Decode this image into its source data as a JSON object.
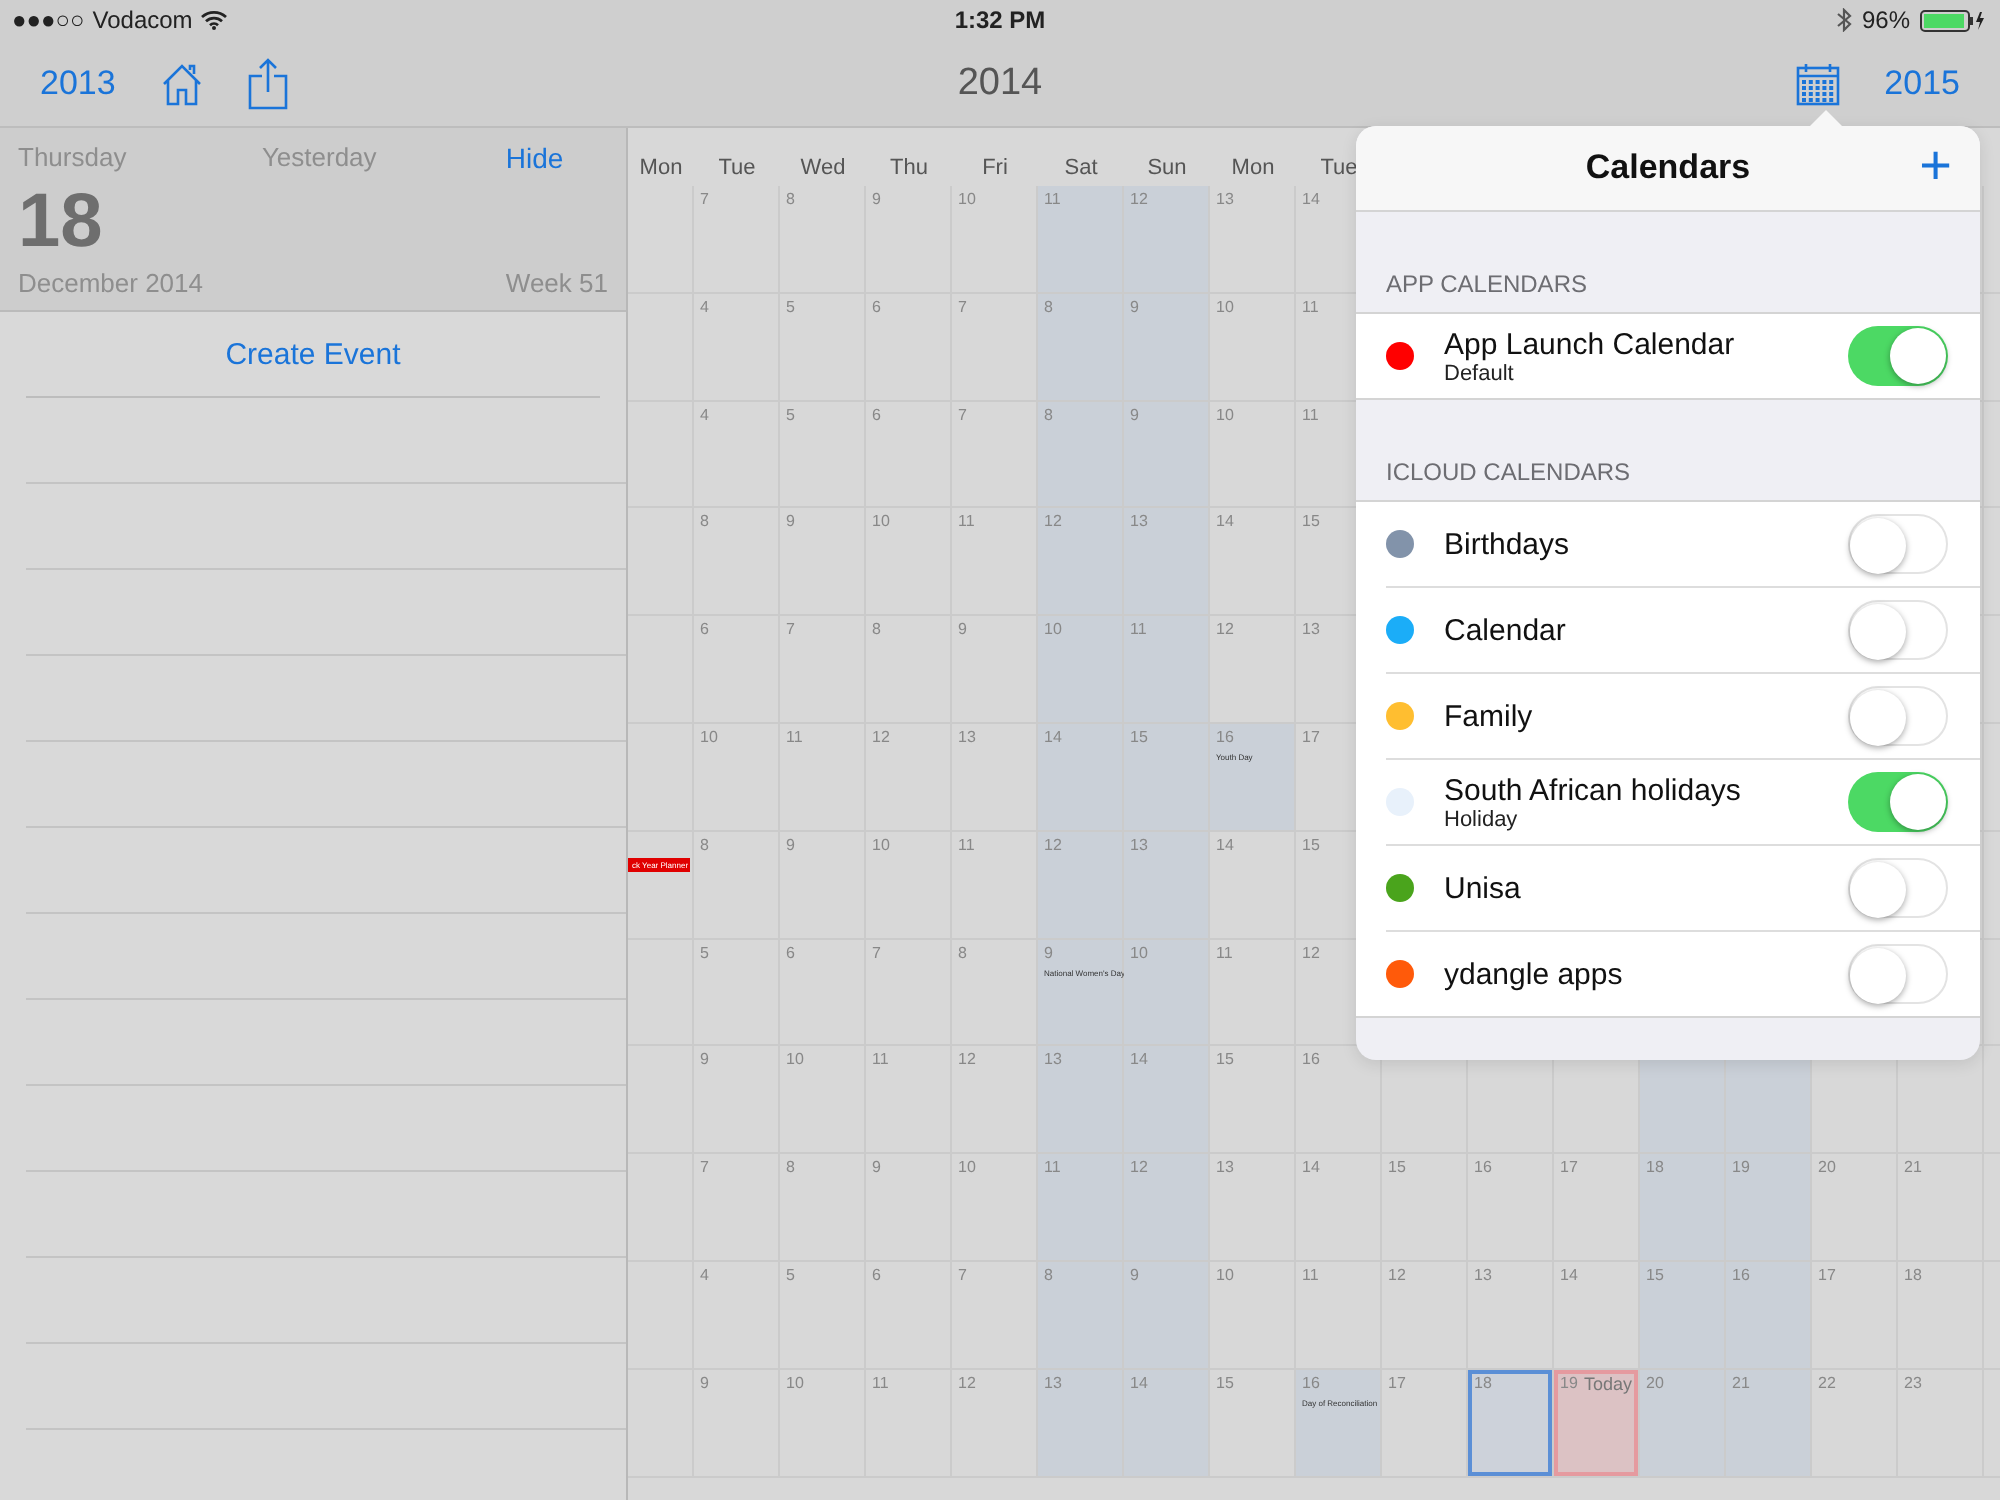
{
  "status_bar": {
    "signal": "●●●○○",
    "carrier": "Vodacom",
    "time": "1:32 PM",
    "battery": "96%"
  },
  "nav": {
    "previous_year": "2013",
    "title": "2014",
    "next_year": "2015"
  },
  "day_panel": {
    "weekday": "Thursday",
    "relative": "Yesterday",
    "hide": "Hide",
    "day": "18",
    "month_year": "December 2014",
    "week": "Week 51",
    "create_event": "Create Event"
  },
  "year_grid": {
    "headers": [
      "Mon",
      "Tue",
      "Wed",
      "Thu",
      "Fri",
      "Sat",
      "Sun",
      "Mon",
      "Tue"
    ],
    "months": [
      {
        "cells": [
          {
            "kind": "blank"
          },
          {
            "kind": "weekday",
            "day": "7"
          },
          {
            "kind": "weekday",
            "day": "8"
          },
          {
            "kind": "weekday",
            "day": "9"
          },
          {
            "kind": "weekday",
            "day": "10"
          },
          {
            "kind": "weekend",
            "day": "11"
          },
          {
            "kind": "weekend",
            "day": "12"
          },
          {
            "kind": "weekday",
            "day": "13"
          },
          {
            "kind": "weekday",
            "day": "14"
          }
        ]
      },
      {
        "cells": [
          {
            "kind": "blank"
          },
          {
            "kind": "weekday",
            "day": "4"
          },
          {
            "kind": "weekday",
            "day": "5"
          },
          {
            "kind": "weekday",
            "day": "6"
          },
          {
            "kind": "weekday",
            "day": "7"
          },
          {
            "kind": "weekend",
            "day": "8"
          },
          {
            "kind": "weekend",
            "day": "9"
          },
          {
            "kind": "weekday",
            "day": "10"
          },
          {
            "kind": "weekday",
            "day": "11"
          }
        ]
      },
      {
        "cells": [
          {
            "kind": "blank"
          },
          {
            "kind": "weekday",
            "day": "4"
          },
          {
            "kind": "weekday",
            "day": "5"
          },
          {
            "kind": "weekday",
            "day": "6"
          },
          {
            "kind": "weekday",
            "day": "7"
          },
          {
            "kind": "weekend",
            "day": "8"
          },
          {
            "kind": "weekend",
            "day": "9"
          },
          {
            "kind": "weekday",
            "day": "10"
          },
          {
            "kind": "weekday",
            "day": "11"
          }
        ]
      },
      {
        "cells": [
          {
            "kind": "blank"
          },
          {
            "kind": "weekday",
            "day": "8"
          },
          {
            "kind": "weekday",
            "day": "9"
          },
          {
            "kind": "weekday",
            "day": "10"
          },
          {
            "kind": "weekday",
            "day": "11"
          },
          {
            "kind": "weekend",
            "day": "12"
          },
          {
            "kind": "weekend",
            "day": "13"
          },
          {
            "kind": "weekday",
            "day": "14"
          },
          {
            "kind": "weekday",
            "day": "15"
          }
        ]
      },
      {
        "cells": [
          {
            "kind": "blank"
          },
          {
            "kind": "weekday",
            "day": "6"
          },
          {
            "kind": "weekday",
            "day": "7"
          },
          {
            "kind": "weekday",
            "day": "8"
          },
          {
            "kind": "weekday",
            "day": "9"
          },
          {
            "kind": "weekend",
            "day": "10"
          },
          {
            "kind": "weekend",
            "day": "11"
          },
          {
            "kind": "weekday",
            "day": "12"
          },
          {
            "kind": "weekday",
            "day": "13"
          }
        ]
      },
      {
        "cells": [
          {
            "kind": "blank"
          },
          {
            "kind": "weekday",
            "day": "10"
          },
          {
            "kind": "weekday",
            "day": "11"
          },
          {
            "kind": "weekday",
            "day": "12"
          },
          {
            "kind": "weekday",
            "day": "13"
          },
          {
            "kind": "weekend",
            "day": "14"
          },
          {
            "kind": "weekend",
            "day": "15"
          },
          {
            "kind": "holiday",
            "day": "16",
            "note": "Youth Day"
          },
          {
            "kind": "weekday",
            "day": "17"
          }
        ]
      },
      {
        "cells": [
          {
            "kind": "event",
            "note": "ck Year Planner",
            "color": "#e00000"
          },
          {
            "kind": "weekday",
            "day": "8"
          },
          {
            "kind": "weekday",
            "day": "9"
          },
          {
            "kind": "weekday",
            "day": "10"
          },
          {
            "kind": "weekday",
            "day": "11"
          },
          {
            "kind": "weekend",
            "day": "12"
          },
          {
            "kind": "weekend",
            "day": "13"
          },
          {
            "kind": "weekday",
            "day": "14"
          },
          {
            "kind": "weekday",
            "day": "15"
          }
        ]
      },
      {
        "cells": [
          {
            "kind": "blank"
          },
          {
            "kind": "weekday",
            "day": "5"
          },
          {
            "kind": "weekday",
            "day": "6"
          },
          {
            "kind": "weekday",
            "day": "7"
          },
          {
            "kind": "weekday",
            "day": "8"
          },
          {
            "kind": "holiday",
            "day": "9",
            "note": "National Women's Day"
          },
          {
            "kind": "weekend",
            "day": "10"
          },
          {
            "kind": "weekday",
            "day": "11"
          },
          {
            "kind": "weekday",
            "day": "12"
          }
        ]
      },
      {
        "cells": [
          {
            "kind": "blank"
          },
          {
            "kind": "weekday",
            "day": "9"
          },
          {
            "kind": "weekday",
            "day": "10"
          },
          {
            "kind": "weekday",
            "day": "11"
          },
          {
            "kind": "weekday",
            "day": "12"
          },
          {
            "kind": "weekend",
            "day": "13"
          },
          {
            "kind": "weekend",
            "day": "14"
          },
          {
            "kind": "weekday",
            "day": "15"
          },
          {
            "kind": "weekday",
            "day": "16"
          },
          {
            "kind": "blank"
          },
          {
            "kind": "blank"
          },
          {
            "kind": "blank"
          },
          {
            "kind": "weekend"
          },
          {
            "kind": "weekend"
          }
        ]
      },
      {
        "cells": [
          {
            "kind": "blank"
          },
          {
            "kind": "weekday",
            "day": "7"
          },
          {
            "kind": "weekday",
            "day": "8"
          },
          {
            "kind": "weekday",
            "day": "9"
          },
          {
            "kind": "weekday",
            "day": "10"
          },
          {
            "kind": "weekend",
            "day": "11"
          },
          {
            "kind": "weekend",
            "day": "12"
          },
          {
            "kind": "weekday",
            "day": "13"
          },
          {
            "kind": "weekday",
            "day": "14"
          },
          {
            "kind": "weekday",
            "day": "15"
          },
          {
            "kind": "weekday",
            "day": "16"
          },
          {
            "kind": "weekday",
            "day": "17"
          },
          {
            "kind": "weekend",
            "day": "18"
          },
          {
            "kind": "weekend",
            "day": "19"
          },
          {
            "kind": "weekday",
            "day": "20"
          },
          {
            "kind": "weekday",
            "day": "21"
          }
        ]
      },
      {
        "cells": [
          {
            "kind": "blank"
          },
          {
            "kind": "weekday",
            "day": "4"
          },
          {
            "kind": "weekday",
            "day": "5"
          },
          {
            "kind": "weekday",
            "day": "6"
          },
          {
            "kind": "weekday",
            "day": "7"
          },
          {
            "kind": "weekend",
            "day": "8"
          },
          {
            "kind": "weekend",
            "day": "9"
          },
          {
            "kind": "weekday",
            "day": "10"
          },
          {
            "kind": "weekday",
            "day": "11"
          },
          {
            "kind": "weekday",
            "day": "12"
          },
          {
            "kind": "weekday",
            "day": "13"
          },
          {
            "kind": "weekday",
            "day": "14"
          },
          {
            "kind": "weekend",
            "day": "15"
          },
          {
            "kind": "weekend",
            "day": "16"
          },
          {
            "kind": "weekday",
            "day": "17"
          },
          {
            "kind": "weekday",
            "day": "18"
          }
        ]
      },
      {
        "cells": [
          {
            "kind": "blank"
          },
          {
            "kind": "weekday",
            "day": "9"
          },
          {
            "kind": "weekday",
            "day": "10"
          },
          {
            "kind": "weekday",
            "day": "11"
          },
          {
            "kind": "weekday",
            "day": "12"
          },
          {
            "kind": "weekend",
            "day": "13"
          },
          {
            "kind": "weekend",
            "day": "14"
          },
          {
            "kind": "weekday",
            "day": "15"
          },
          {
            "kind": "holiday",
            "day": "16",
            "note": "Day of Reconciliation"
          },
          {
            "kind": "weekday",
            "day": "17"
          },
          {
            "kind": "selected",
            "day": "18"
          },
          {
            "kind": "today",
            "day": "19",
            "label": "Today"
          },
          {
            "kind": "weekend",
            "day": "20"
          },
          {
            "kind": "weekend",
            "day": "21"
          },
          {
            "kind": "weekday",
            "day": "22"
          },
          {
            "kind": "weekday",
            "day": "23"
          }
        ]
      }
    ]
  },
  "calendars_popover": {
    "title": "Calendars",
    "add": "+",
    "sections": [
      {
        "header": "APP CALENDARS",
        "items": [
          {
            "name": "App Launch Calendar",
            "subtitle": "Default",
            "color": "#ff0000",
            "on": true
          }
        ]
      },
      {
        "header": "ICLOUD CALENDARS",
        "items": [
          {
            "name": "Birthdays",
            "color": "#8293aa",
            "on": false
          },
          {
            "name": "Calendar",
            "color": "#1badf8",
            "on": false
          },
          {
            "name": "Family",
            "color": "#ffbe30",
            "on": false
          },
          {
            "name": "South African holidays",
            "subtitle": "Holiday",
            "color": "#e8f1fb",
            "on": true
          },
          {
            "name": "Unisa",
            "color": "#4aa41c",
            "on": false
          },
          {
            "name": "ydangle apps",
            "color": "#ff5a0a",
            "on": false
          }
        ]
      }
    ]
  }
}
